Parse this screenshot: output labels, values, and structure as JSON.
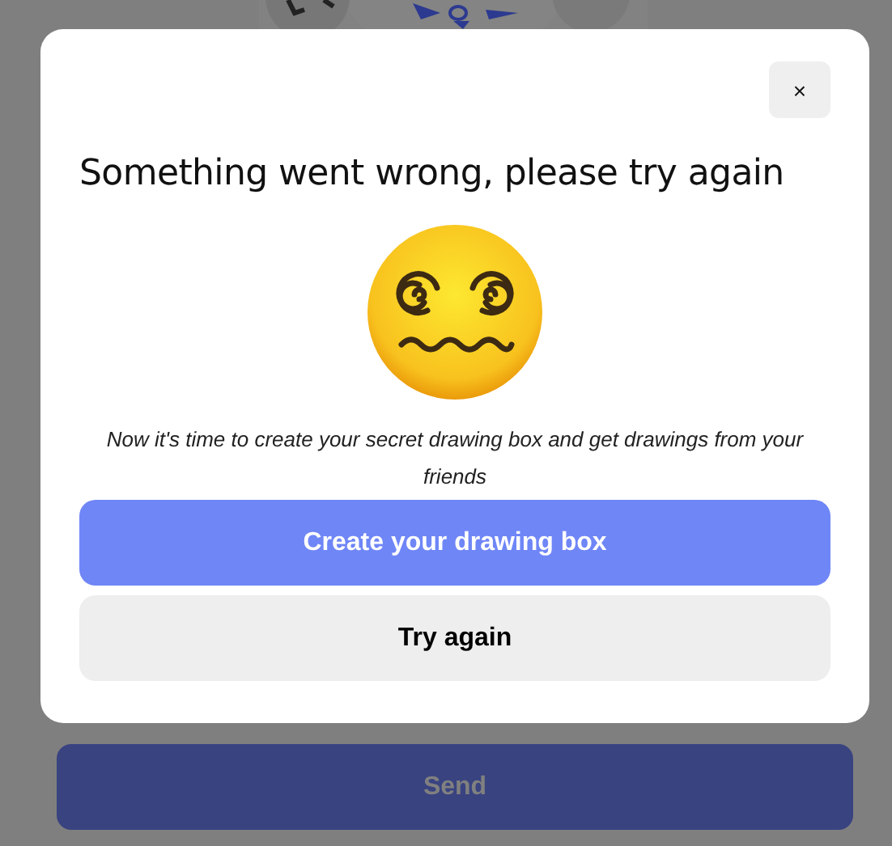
{
  "dialog": {
    "close_label": "×",
    "title": "Something went wrong, please try again",
    "message": "Now it's time to create your secret drawing box and get drawings from your friends",
    "buttons": [
      {
        "label": "Create your drawing box",
        "kind": "primary"
      },
      {
        "label": "Try again",
        "kind": "secondary"
      }
    ]
  },
  "send_button": {
    "label": "Send",
    "disabled": true
  }
}
